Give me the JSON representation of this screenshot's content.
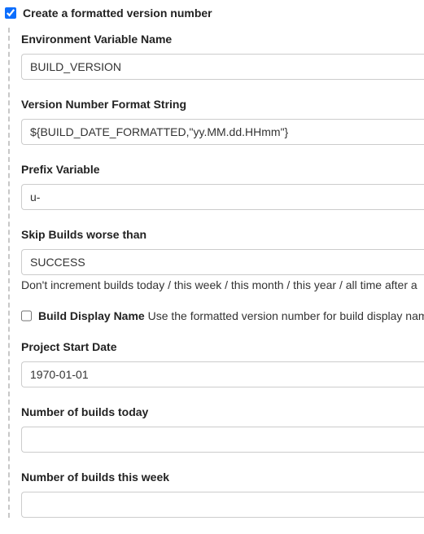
{
  "top": {
    "checked": true,
    "title": "Create a formatted version number"
  },
  "fields": {
    "envVarName": {
      "label": "Environment Variable Name",
      "value": "BUILD_VERSION"
    },
    "formatString": {
      "label": "Version Number Format String",
      "value": "${BUILD_DATE_FORMATTED,\"yy.MM.dd.HHmm\"}"
    },
    "prefixVariable": {
      "label": "Prefix Variable",
      "value": "u-"
    },
    "skipBuilds": {
      "label": "Skip Builds worse than",
      "value": "SUCCESS",
      "help": "Don't increment builds today / this week / this month / this year / all time after a"
    },
    "buildDisplayName": {
      "checked": false,
      "label": "Build Display Name",
      "desc": "Use the formatted version number for build display nam"
    },
    "projectStartDate": {
      "label": "Project Start Date",
      "value": "1970-01-01"
    },
    "buildsToday": {
      "label": "Number of builds today",
      "value": ""
    },
    "buildsThisWeek": {
      "label": "Number of builds this week",
      "value": ""
    }
  }
}
